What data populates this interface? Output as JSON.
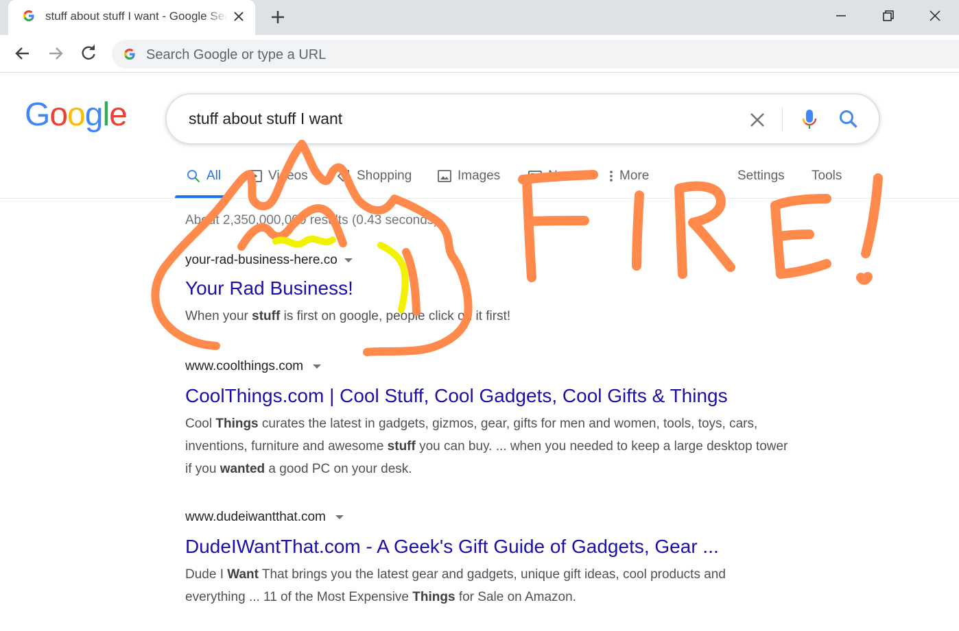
{
  "browser": {
    "tab_title": "stuff about stuff I want - Google Search",
    "omnibox_placeholder": "Search Google or type a URL"
  },
  "google": {
    "logo": [
      "G",
      "o",
      "o",
      "g",
      "l",
      "e"
    ],
    "logo_colors": [
      "#4285F4",
      "#EA4335",
      "#FBBC05",
      "#4285F4",
      "#34A853",
      "#EA4335"
    ],
    "query": "stuff about stuff I want"
  },
  "nav": {
    "all": "All",
    "videos": "Videos",
    "shopping": "Shopping",
    "images": "Images",
    "news": "News",
    "more": "More",
    "settings": "Settings",
    "tools": "Tools"
  },
  "stats": "About 2,350,000,000 results (0.43 seconds)",
  "results": [
    {
      "url": "your-rad-business-here.co",
      "title": "Your Rad Business!",
      "snippet_parts": [
        [
          "When your ",
          false
        ],
        [
          "stuff",
          true
        ],
        [
          " is first on google, people click on it first!",
          false
        ]
      ]
    },
    {
      "url": "www.coolthings.com",
      "title": "CoolThings.com | Cool Stuff, Cool Gadgets, Cool Gifts & Things",
      "snippet_parts": [
        [
          "Cool ",
          false
        ],
        [
          "Things",
          true
        ],
        [
          " curates the latest in gadgets, gizmos, gear, gifts for men and women, tools, toys, cars, inventions, furniture and awesome ",
          false
        ],
        [
          "stuff",
          true
        ],
        [
          " you can buy. ... when you needed to keep a large desktop tower if you ",
          false
        ],
        [
          "wanted",
          true
        ],
        [
          " a good PC on your desk.",
          false
        ]
      ]
    },
    {
      "url": "www.dudeiwantthat.com",
      "title": "DudeIWantThat.com - A Geek's Gift Guide of Gadgets, Gear ...",
      "snippet_parts": [
        [
          "Dude I ",
          false
        ],
        [
          "Want",
          true
        ],
        [
          " That brings you the latest gear and gadgets, unique gift ideas, cool products and everything ... 11 of the Most Expensive ",
          false
        ],
        [
          "Things",
          true
        ],
        [
          " for Sale on Amazon.",
          false
        ]
      ]
    }
  ],
  "annotation": {
    "text": "FIRE!",
    "color": "#ff8a4c",
    "highlight_color": "#f2f200"
  }
}
